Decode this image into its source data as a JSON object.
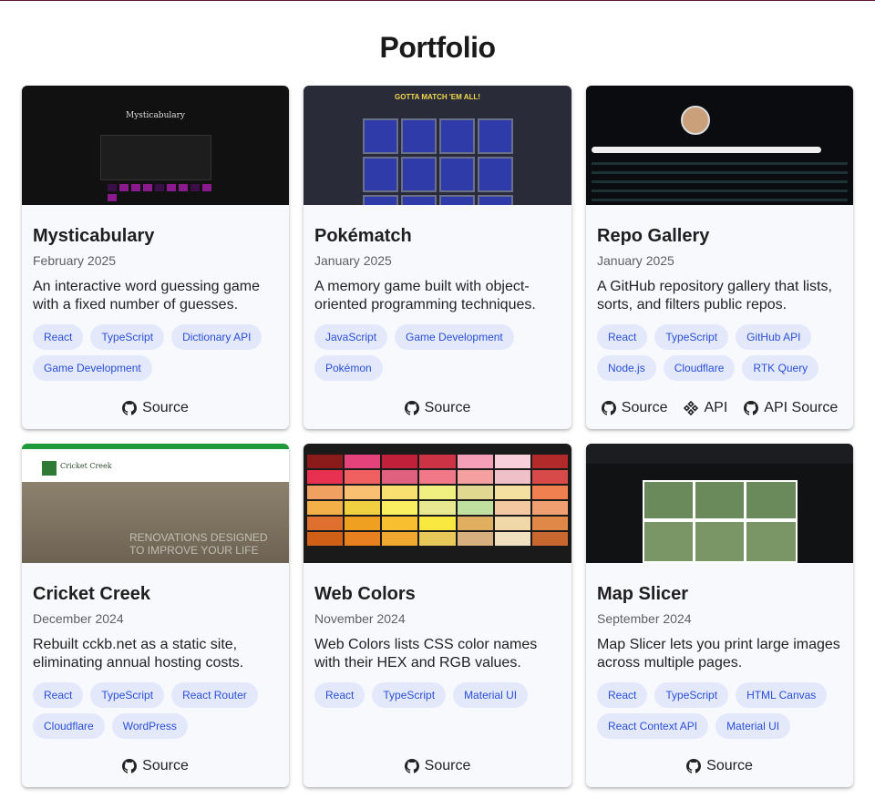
{
  "page": {
    "title": "Portfolio"
  },
  "projects": [
    {
      "title": "Mysticabulary",
      "date": "February 2025",
      "description": "An interactive word guessing game with a fixed number of guesses.",
      "tags": [
        "React",
        "TypeScript",
        "Dictionary API",
        "Game Development"
      ],
      "links": [
        {
          "label": "Source",
          "icon": "github-icon"
        }
      ]
    },
    {
      "title": "Pokématch",
      "date": "January 2025",
      "description": "A memory game built with object-oriented programming techniques.",
      "tags": [
        "JavaScript",
        "Game Development",
        "Pokémon"
      ],
      "links": [
        {
          "label": "Source",
          "icon": "github-icon"
        }
      ],
      "thumb_header": "GOTTA MATCH 'EM ALL!"
    },
    {
      "title": "Repo Gallery",
      "date": "January 2025",
      "description": "A GitHub repository gallery that lists, sorts, and filters public repos.",
      "tags": [
        "React",
        "TypeScript",
        "GitHub API",
        "Node.js",
        "Cloudflare",
        "RTK Query"
      ],
      "links": [
        {
          "label": "Source",
          "icon": "github-icon"
        },
        {
          "label": "API",
          "icon": "api-icon"
        },
        {
          "label": "API Source",
          "icon": "github-icon"
        }
      ]
    },
    {
      "title": "Cricket Creek",
      "date": "December 2024",
      "description": "Rebuilt cckb.net as a static site, eliminating annual hosting costs.",
      "tags": [
        "React",
        "TypeScript",
        "React Router",
        "Cloudflare",
        "WordPress"
      ],
      "links": [
        {
          "label": "Source",
          "icon": "github-icon"
        }
      ],
      "thumb_overlay": "RENOVATIONS DESIGNED TO IMPROVE YOUR LIFE"
    },
    {
      "title": "Web Colors",
      "date": "November 2024",
      "description": "Web Colors lists CSS color names with their HEX and RGB values.",
      "tags": [
        "React",
        "TypeScript",
        "Material UI"
      ],
      "links": [
        {
          "label": "Source",
          "icon": "github-icon"
        }
      ]
    },
    {
      "title": "Map Slicer",
      "date": "September 2024",
      "description": "Map Slicer lets you print large images across multiple pages.",
      "tags": [
        "React",
        "TypeScript",
        "HTML Canvas",
        "React Context API",
        "Material UI"
      ],
      "links": [
        {
          "label": "Source",
          "icon": "github-icon"
        }
      ]
    }
  ],
  "colors": {
    "tag_bg": "#e3e8fb",
    "tag_text": "#2a4fd7",
    "card_bg": "#f8f9fd"
  }
}
